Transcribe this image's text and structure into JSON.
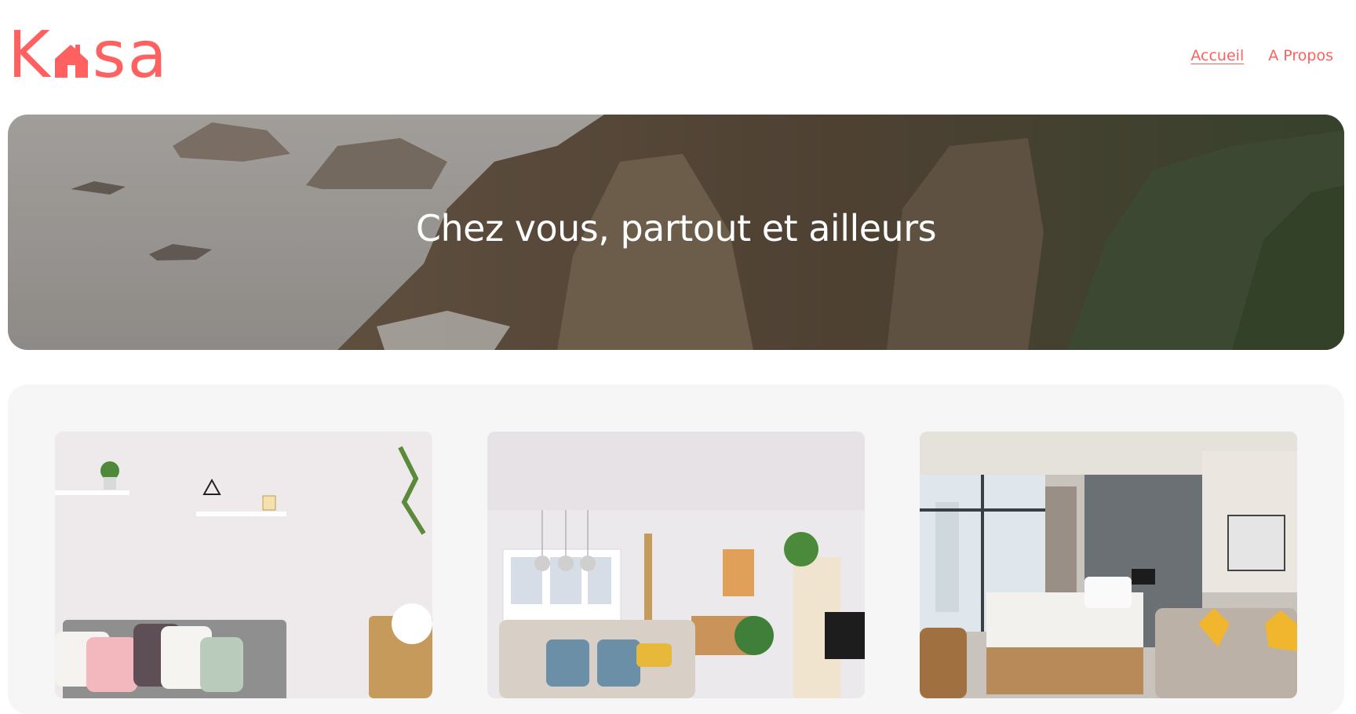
{
  "brand": {
    "logo_text": "Kasa",
    "color": "#FF6060"
  },
  "nav": {
    "items": [
      {
        "label": "Accueil",
        "active": true
      },
      {
        "label": "A Propos",
        "active": false
      }
    ]
  },
  "banner": {
    "title": "Chez vous, partout et ailleurs",
    "image": "coastal cliffs with forest photo"
  },
  "gallery": {
    "cards": [
      {
        "image": "bright living room with grey sofa and shelves"
      },
      {
        "image": "open living room with pendant lights and white sofa"
      },
      {
        "image": "hotel bedroom with large window and sofa"
      }
    ]
  }
}
